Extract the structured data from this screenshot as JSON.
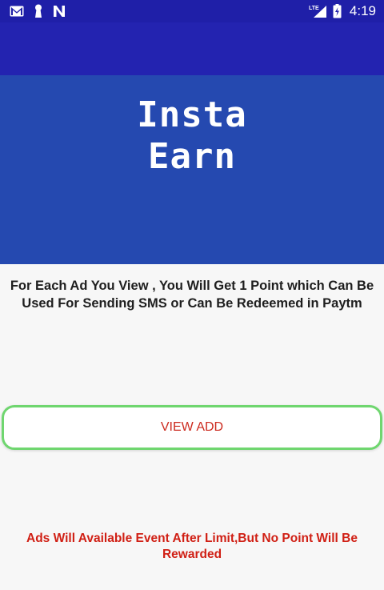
{
  "status_bar": {
    "time": "4:19",
    "network_label": "LTE",
    "left_icons": [
      "gmail-icon",
      "keyhole-icon",
      "n-logo-icon"
    ],
    "right_icons": [
      "lte-signal-icon",
      "battery-icon"
    ],
    "color": "#1f1fa8"
  },
  "app_bar": {
    "color": "#2323b0"
  },
  "hero": {
    "logo_line1": "Insta",
    "logo_line2": "Earn",
    "color": "#2549b0"
  },
  "main": {
    "info_text": "For Each Ad You View , You Will Get 1 Point which Can Be Used For Sending SMS or Can Be Redeemed in Paytm",
    "view_add_button": "VIEW ADD",
    "warning_text": "Ads Will Available Event After Limit,But No Point Will Be Rewarded",
    "accent_green": "#6fd66f",
    "warning_red": "#d01f14"
  }
}
